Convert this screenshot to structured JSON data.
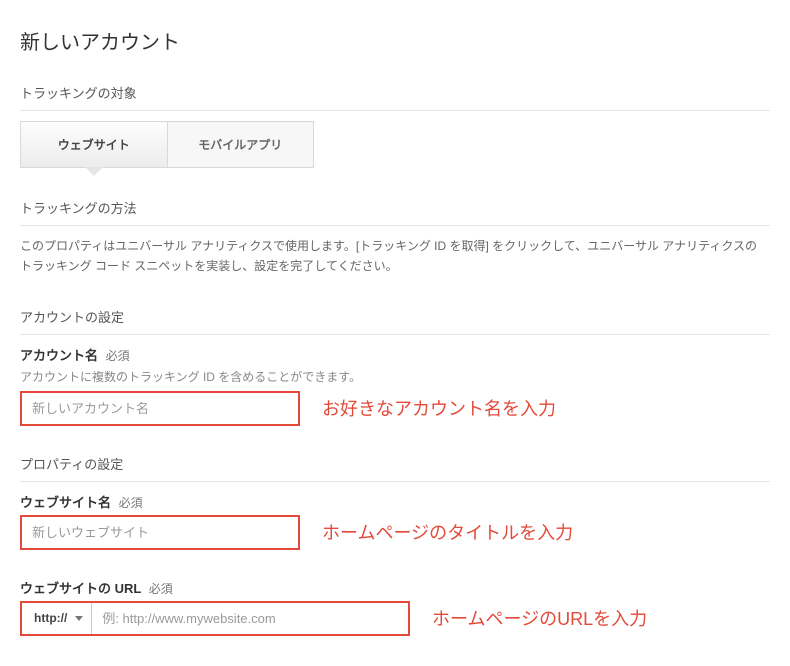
{
  "title": "新しいアカウント",
  "tracking_target": {
    "label": "トラッキングの対象",
    "tabs": {
      "website": "ウェブサイト",
      "mobile": "モバイルアプリ"
    }
  },
  "tracking_method": {
    "label": "トラッキングの方法",
    "desc": "このプロパティはユニバーサル アナリティクスで使用します。[トラッキング ID を取得] をクリックして、ユニバーサル アナリティクスのトラッキング コード スニペットを実装し、設定を完了してください。"
  },
  "account": {
    "section": "アカウントの設定",
    "name_label": "アカウント名",
    "required": "必須",
    "help": "アカウントに複数のトラッキング ID を含めることができます。",
    "placeholder": "新しいアカウント名",
    "annotation": "お好きなアカウント名を入力"
  },
  "property": {
    "section": "プロパティの設定",
    "site_name_label": "ウェブサイト名",
    "site_name_placeholder": "新しいウェブサイト",
    "site_name_annotation": "ホームページのタイトルを入力",
    "url_label": "ウェブサイトの URL",
    "scheme": "http://",
    "url_placeholder": "例: http://www.mywebsite.com",
    "url_annotation": "ホームページのURLを入力",
    "required": "必須"
  }
}
